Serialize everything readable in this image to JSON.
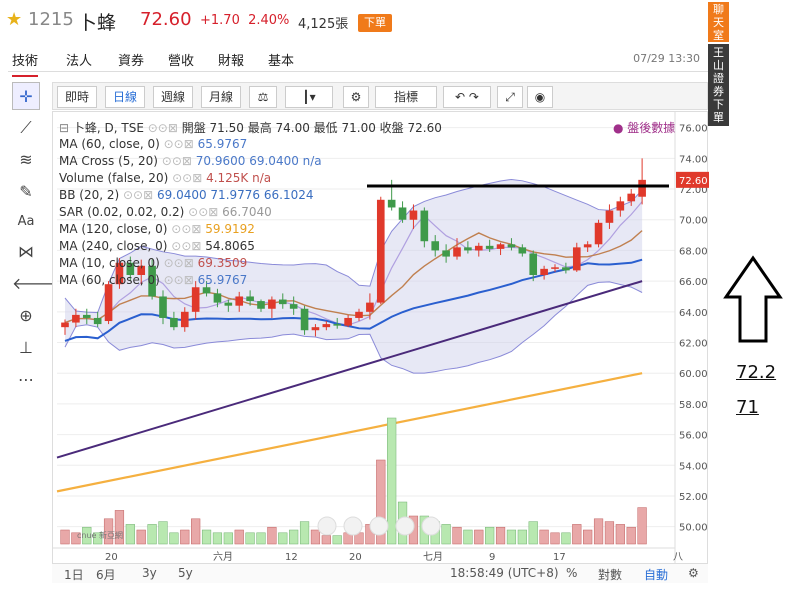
{
  "header": {
    "code": "1215",
    "name": "卜蜂",
    "price": "72.60",
    "change": "+1.70",
    "change_pct": "2.40%",
    "volume": "4,125張",
    "order_label": "下單"
  },
  "tabs": [
    {
      "label": "技術",
      "active": true
    },
    {
      "label": "法人"
    },
    {
      "label": "資券"
    },
    {
      "label": "營收"
    },
    {
      "label": "財報"
    },
    {
      "label": "基本"
    }
  ],
  "datetime": "07/29 13:30",
  "chart_toolbar": {
    "intraday": "即時",
    "daily": "日線",
    "weekly": "週線",
    "monthly": "月線",
    "indicators": "指標"
  },
  "legend": {
    "title": "卜蜂, D, TSE",
    "ohlc": "開盤 71.50 最高 74.00 最低 71.00 收盤 72.60",
    "after_hours": "盤後數據",
    "rows": [
      {
        "label": "MA (60, close, 0)",
        "value": "65.9767",
        "color": "#4a78c8"
      },
      {
        "label": "MA Cross (5, 20)",
        "value": "70.9600  69.0400  n/a",
        "color": "#4a78c8"
      },
      {
        "label": "Volume (false, 20)",
        "value": "4.125K  n/a",
        "color": "#c0504d"
      },
      {
        "label": "BB (20, 2)",
        "value": "69.0400  71.9776  66.1024",
        "color": "#3a6ec0"
      },
      {
        "label": "SAR (0.02, 0.02, 0.2)",
        "value": "66.7040",
        "color": "#999999"
      },
      {
        "label": "MA (120, close, 0)",
        "value": "59.9192",
        "color": "#e8a020"
      },
      {
        "label": "MA (240, close, 0)",
        "value": "54.8065",
        "color": "#333333"
      },
      {
        "label": "MA (10, close, 0)",
        "value": "69.3509",
        "color": "#c0504d"
      },
      {
        "label": "MA (60, close, 0)",
        "value": "65.9767",
        "color": "#4a78c8"
      }
    ]
  },
  "price_axis": [
    "76.00",
    "74.00",
    "72.00",
    "70.00",
    "68.00",
    "66.00",
    "64.00",
    "62.00",
    "60.00",
    "58.00",
    "56.00",
    "54.00",
    "52.00",
    "50.00"
  ],
  "current_price_tag": "72.60",
  "time_axis": [
    "20",
    "六月",
    "12",
    "20",
    "七月",
    "9",
    "17",
    "八"
  ],
  "bottom": {
    "ranges": [
      "1日",
      "6月",
      "3y",
      "5y"
    ],
    "clock": "18:58:49 (UTC+8)",
    "pct": "%",
    "log": "對數",
    "auto": "自動"
  },
  "watermark": "cnue 新亞網",
  "side": {
    "chat": "聊天室",
    "broker": "王山證券下單"
  },
  "annotation": {
    "line1": "72.2",
    "line2": "71"
  },
  "chart_data": {
    "type": "candlestick",
    "ylim": [
      49,
      76.5
    ],
    "candles": [
      [
        63.0,
        63.5,
        62.5,
        63.3
      ],
      [
        63.3,
        64.2,
        63.0,
        63.8
      ],
      [
        63.8,
        64.2,
        63.2,
        63.6
      ],
      [
        63.6,
        64.0,
        63.0,
        63.2
      ],
      [
        63.4,
        66.0,
        63.2,
        65.8
      ],
      [
        65.8,
        67.5,
        65.5,
        67.2
      ],
      [
        67.2,
        67.6,
        66.0,
        66.4
      ],
      [
        66.4,
        67.4,
        65.8,
        67.0
      ],
      [
        67.0,
        67.4,
        64.8,
        65.0
      ],
      [
        65.0,
        65.4,
        63.2,
        63.6
      ],
      [
        63.6,
        64.0,
        62.8,
        63.0
      ],
      [
        63.0,
        64.3,
        62.7,
        64.0
      ],
      [
        64.0,
        66.0,
        63.5,
        65.6
      ],
      [
        65.6,
        66.0,
        65.0,
        65.2
      ],
      [
        65.2,
        65.5,
        64.3,
        64.6
      ],
      [
        64.6,
        64.8,
        64.0,
        64.4
      ],
      [
        64.4,
        65.3,
        64.0,
        65.0
      ],
      [
        65.0,
        65.4,
        64.4,
        64.7
      ],
      [
        64.7,
        64.8,
        64.0,
        64.2
      ],
      [
        64.2,
        65.0,
        63.6,
        64.8
      ],
      [
        64.8,
        65.2,
        64.2,
        64.5
      ],
      [
        64.5,
        65.0,
        63.8,
        64.2
      ],
      [
        64.2,
        64.4,
        62.5,
        62.8
      ],
      [
        62.8,
        63.2,
        62.4,
        63.0
      ],
      [
        63.0,
        63.4,
        62.8,
        63.2
      ],
      [
        63.2,
        63.6,
        62.9,
        63.1
      ],
      [
        63.1,
        63.8,
        63.0,
        63.6
      ],
      [
        63.6,
        64.2,
        63.4,
        64.0
      ],
      [
        64.0,
        65.2,
        63.5,
        64.6
      ],
      [
        64.6,
        71.5,
        64.5,
        71.3
      ],
      [
        71.3,
        72.6,
        70.6,
        70.8
      ],
      [
        70.8,
        71.2,
        69.8,
        70.0
      ],
      [
        70.0,
        71.0,
        69.4,
        70.6
      ],
      [
        70.6,
        70.8,
        68.2,
        68.6
      ],
      [
        68.6,
        69.0,
        67.6,
        68.0
      ],
      [
        68.0,
        68.4,
        67.2,
        67.6
      ],
      [
        67.6,
        68.8,
        67.4,
        68.2
      ],
      [
        68.2,
        68.6,
        67.8,
        68.0
      ],
      [
        68.0,
        68.5,
        67.6,
        68.3
      ],
      [
        68.3,
        68.7,
        67.9,
        68.1
      ],
      [
        68.1,
        68.5,
        67.7,
        68.4
      ],
      [
        68.4,
        68.8,
        68.0,
        68.2
      ],
      [
        68.2,
        68.4,
        67.6,
        67.8
      ],
      [
        67.8,
        68.0,
        66.0,
        66.4
      ],
      [
        66.4,
        67.0,
        66.1,
        66.8
      ],
      [
        66.8,
        67.1,
        66.6,
        66.9
      ],
      [
        66.9,
        67.2,
        66.5,
        66.7
      ],
      [
        66.7,
        68.5,
        66.6,
        68.2
      ],
      [
        68.2,
        68.6,
        67.9,
        68.4
      ],
      [
        68.4,
        70.0,
        68.2,
        69.8
      ],
      [
        69.8,
        71.0,
        69.4,
        70.6
      ],
      [
        70.6,
        71.5,
        70.2,
        71.2
      ],
      [
        71.2,
        72.0,
        70.9,
        71.7
      ],
      [
        71.5,
        74.0,
        71.0,
        72.6
      ]
    ],
    "volumes": [
      0.5,
      0.4,
      0.6,
      0.4,
      0.9,
      1.2,
      0.7,
      0.5,
      0.7,
      0.8,
      0.4,
      0.5,
      0.9,
      0.5,
      0.4,
      0.4,
      0.5,
      0.4,
      0.4,
      0.6,
      0.4,
      0.5,
      0.8,
      0.5,
      0.3,
      0.3,
      0.4,
      0.4,
      0.7,
      3.0,
      4.5,
      1.5,
      1.0,
      1.0,
      0.8,
      0.7,
      0.6,
      0.5,
      0.5,
      0.6,
      0.6,
      0.5,
      0.5,
      0.8,
      0.5,
      0.4,
      0.4,
      0.7,
      0.5,
      0.9,
      0.8,
      0.7,
      0.6,
      1.3
    ],
    "ma120": [
      [
        0,
        52.3
      ],
      [
        53,
        60.0
      ]
    ],
    "ma240": [
      [
        0,
        54.5
      ],
      [
        53,
        66.0
      ]
    ]
  }
}
